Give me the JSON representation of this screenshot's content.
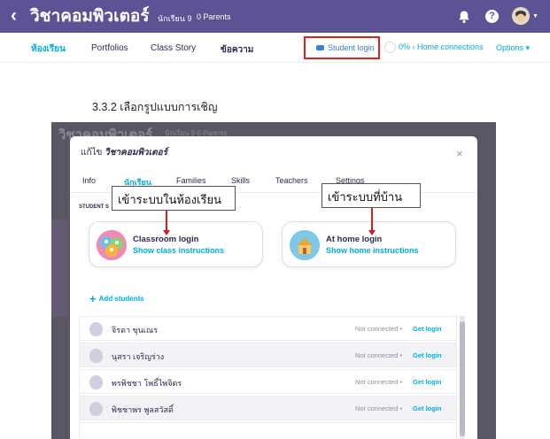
{
  "topbar": {
    "class_name": "วิชาคอมพิวเตอร์",
    "students": "นักเรียน 9",
    "parents": "0 Parents",
    "help_glyph": "?",
    "back_glyph": "‹",
    "icons": [
      "back-chevron-icon",
      "bell-icon",
      "help-icon",
      "avatar",
      "chevron-down-icon"
    ]
  },
  "nav": {
    "tabs": [
      "ห้องเรียน",
      "Portfolios",
      "Class Story",
      "ข้อความ"
    ],
    "student_login": "Student login",
    "home_connections": "0% › Home connections",
    "options": "Options ▾",
    "colors": {
      "topbar": "#5c5394",
      "accent": "#00aedb",
      "highlight": "#e0201f"
    }
  },
  "caption": "3.3.2 เลือกรูปแบบการเชิญ",
  "shot": {
    "bg_title": "วิชาคอมพิวเตอร์",
    "bg_meta": "นักเรียน 9   0 Parents",
    "modal": {
      "title_prefix": "แก้ไข",
      "title_class": "วิชาคอมพิวเตอร์",
      "close": "×",
      "tabs": [
        "Info",
        "นักเรียน",
        "Families",
        "Skills",
        "Teachers",
        "Settings"
      ],
      "section_label": "STUDENT S",
      "callouts": [
        "เข้าระบบในห้องเรียน",
        "เข้าระบบที่บ้าน"
      ],
      "cards": [
        {
          "title": "Classroom login",
          "subtitle": "Show class instructions"
        },
        {
          "title": "At home login",
          "subtitle": "Show home instructions"
        }
      ],
      "add_students": "Add students",
      "add_plus": "+",
      "students": [
        {
          "name": "จิรดา ขุนเณร",
          "status": "Not connected",
          "action": "Get login"
        },
        {
          "name": "นุสรา เจริญร่าง",
          "status": "Not connected",
          "action": "Get login"
        },
        {
          "name": "พรพิชชา โพธิ์ไพจิตร",
          "status": "Not connected",
          "action": "Get login"
        },
        {
          "name": "พิชชาพร พูลสวัสดิ์",
          "status": "Not connected",
          "action": "Get login"
        }
      ],
      "separator": " • "
    }
  }
}
